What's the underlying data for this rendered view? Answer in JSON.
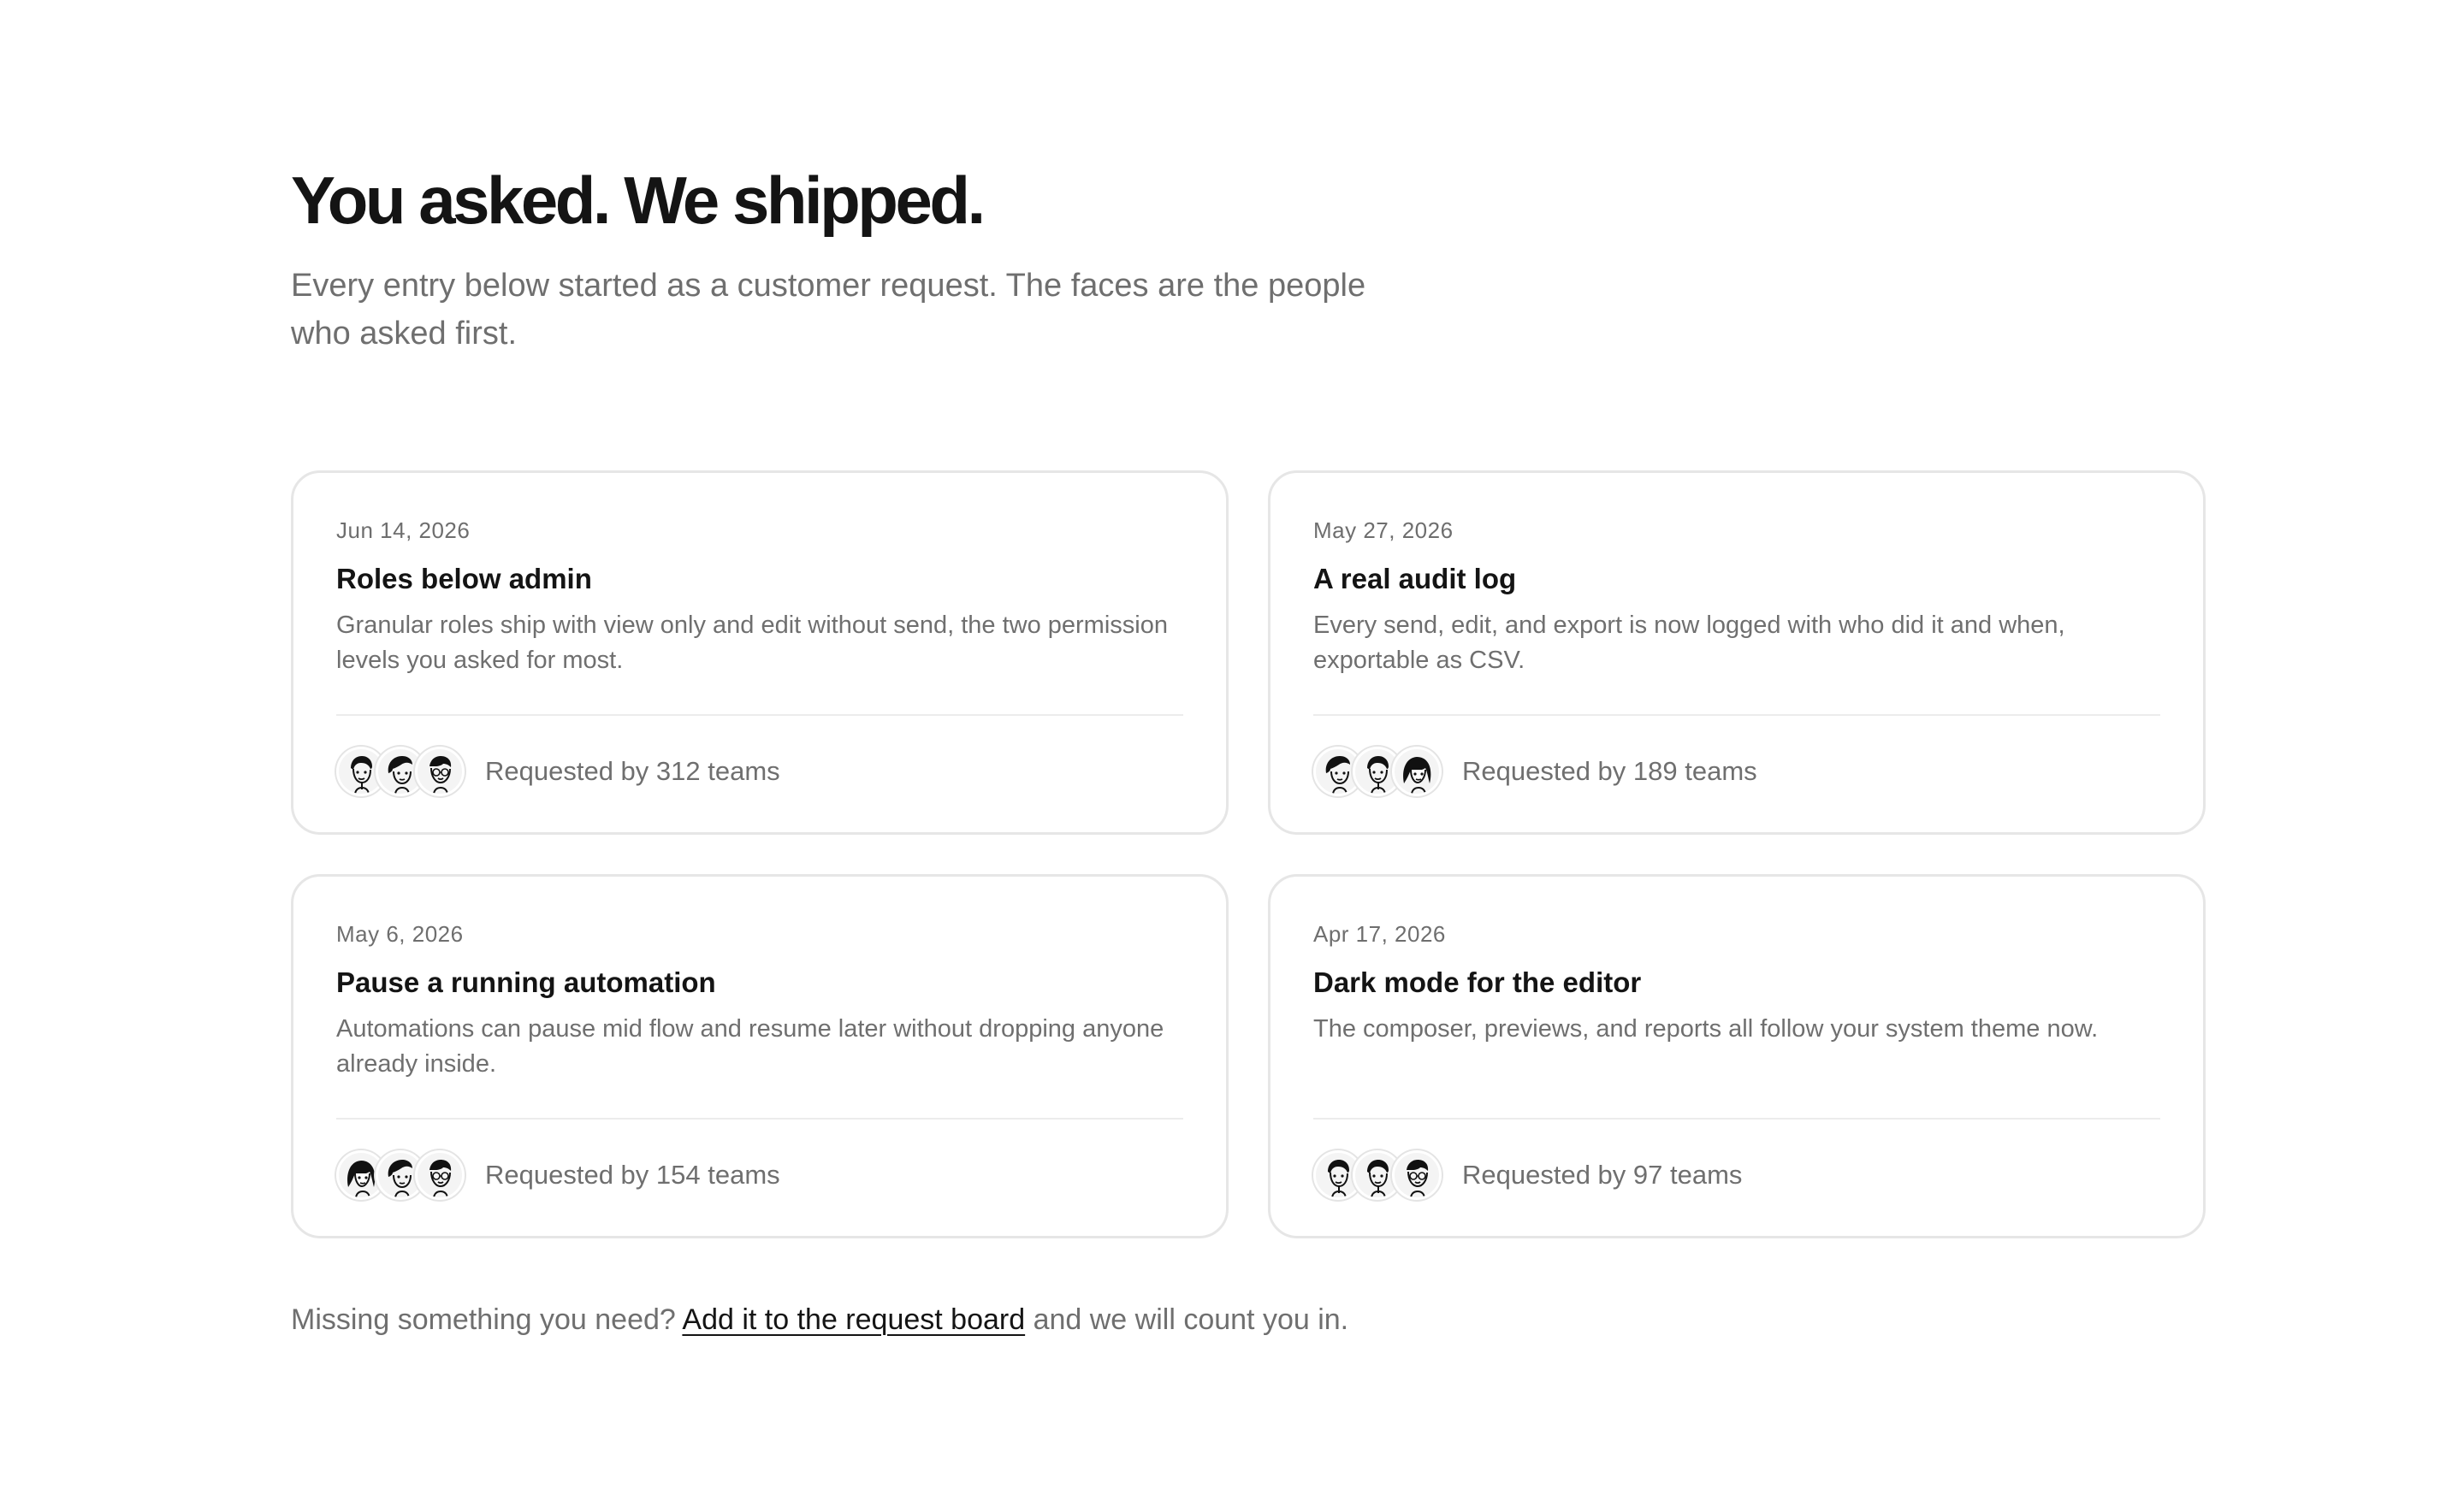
{
  "header": {
    "title": "You asked. We shipped.",
    "subtitle": "Every entry below started as a customer request. The faces are the people who asked first."
  },
  "cards": [
    {
      "date": "Jun 14, 2026",
      "title": "Roles below admin",
      "description": "Granular roles ship with view only and edit without send, the two permission levels you asked for most.",
      "requested": "Requested by 312 teams",
      "avatars": [
        "avatar-face-icon",
        "avatar-face-icon",
        "avatar-face-icon"
      ]
    },
    {
      "date": "May 27, 2026",
      "title": "A real audit log",
      "description": "Every send, edit, and export is now logged with who did it and when, exportable as CSV.",
      "requested": "Requested by 189 teams",
      "avatars": [
        "avatar-face-icon",
        "avatar-face-icon",
        "avatar-face-icon"
      ]
    },
    {
      "date": "May 6, 2026",
      "title": "Pause a running automation",
      "description": "Automations can pause mid flow and resume later without dropping anyone already inside.",
      "requested": "Requested by 154 teams",
      "avatars": [
        "avatar-face-icon",
        "avatar-face-icon",
        "avatar-face-icon"
      ]
    },
    {
      "date": "Apr 17, 2026",
      "title": "Dark mode for the editor",
      "description": "The composer, previews, and reports all follow your system theme now.",
      "requested": "Requested by 97 teams",
      "avatars": [
        "avatar-face-icon",
        "avatar-face-icon",
        "avatar-face-icon"
      ]
    }
  ],
  "footer": {
    "prefix": "Missing something you need?",
    "link_label": "Add it to the request board",
    "suffix": "and we will count you in."
  },
  "colors": {
    "text_primary": "#141414",
    "text_muted": "#6f6f6f",
    "card_border": "#e6e6e6",
    "background": "#ffffff"
  }
}
